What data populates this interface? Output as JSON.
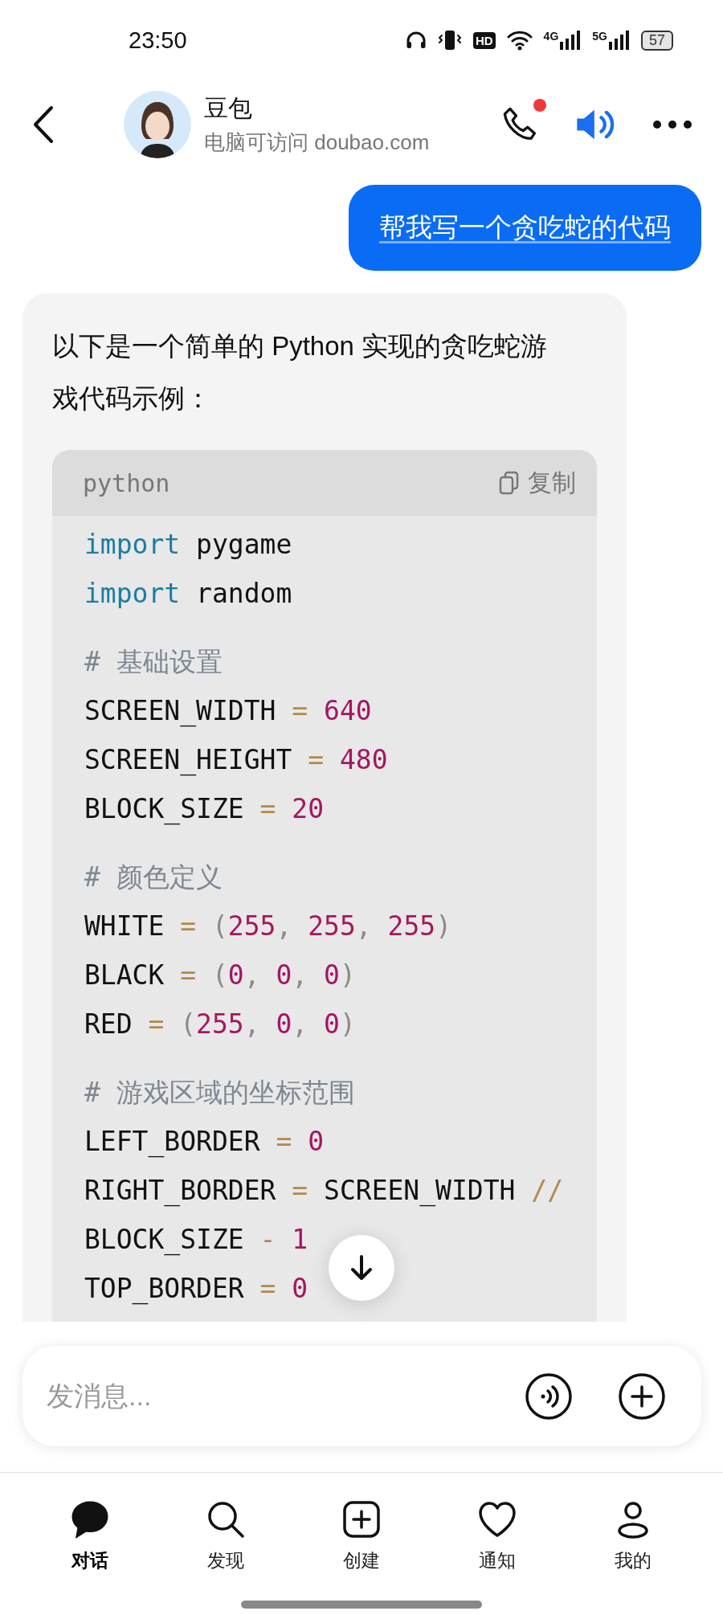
{
  "status_bar": {
    "time": "23:50",
    "hd": "HD",
    "net_4g": "4G",
    "net_5g": "5G",
    "battery": "57"
  },
  "header": {
    "name": "豆包",
    "subtitle": "电脑可访问 doubao.com",
    "call_badge": true
  },
  "messages": [
    {
      "kind": "user",
      "text": "帮我写一个贪吃蛇的代码"
    },
    {
      "kind": "assistant",
      "text": "以下是一个简单的 Python 实现的贪吃蛇游戏代码示例：",
      "code": {
        "language": "python",
        "copy_label": "复制",
        "groups": [
          [
            [
              {
                "kind": "kw",
                "text": "import"
              },
              {
                "kind": "plain",
                "text": " pygame"
              }
            ],
            [
              {
                "kind": "kw",
                "text": "import"
              },
              {
                "kind": "plain",
                "text": " random"
              }
            ]
          ],
          [
            [
              {
                "kind": "comment",
                "text": "# 基础设置"
              }
            ],
            [
              {
                "kind": "plain",
                "text": "SCREEN_WIDTH "
              },
              {
                "kind": "op",
                "text": "= "
              },
              {
                "kind": "num",
                "text": "640"
              }
            ],
            [
              {
                "kind": "plain",
                "text": "SCREEN_HEIGHT "
              },
              {
                "kind": "op",
                "text": "= "
              },
              {
                "kind": "num",
                "text": "480"
              }
            ],
            [
              {
                "kind": "plain",
                "text": "BLOCK_SIZE "
              },
              {
                "kind": "op",
                "text": "= "
              },
              {
                "kind": "num",
                "text": "20"
              }
            ]
          ],
          [
            [
              {
                "kind": "comment",
                "text": "# 颜色定义"
              }
            ],
            [
              {
                "kind": "plain",
                "text": "WHITE "
              },
              {
                "kind": "op",
                "text": "= "
              },
              {
                "kind": "punct",
                "text": "("
              },
              {
                "kind": "num",
                "text": "255"
              },
              {
                "kind": "punct",
                "text": ", "
              },
              {
                "kind": "num",
                "text": "255"
              },
              {
                "kind": "punct",
                "text": ", "
              },
              {
                "kind": "num",
                "text": "255"
              },
              {
                "kind": "punct",
                "text": ")"
              }
            ],
            [
              {
                "kind": "plain",
                "text": "BLACK "
              },
              {
                "kind": "op",
                "text": "= "
              },
              {
                "kind": "punct",
                "text": "("
              },
              {
                "kind": "num",
                "text": "0"
              },
              {
                "kind": "punct",
                "text": ", "
              },
              {
                "kind": "num",
                "text": "0"
              },
              {
                "kind": "punct",
                "text": ", "
              },
              {
                "kind": "num",
                "text": "0"
              },
              {
                "kind": "punct",
                "text": ")"
              }
            ],
            [
              {
                "kind": "plain",
                "text": "RED "
              },
              {
                "kind": "op",
                "text": "= "
              },
              {
                "kind": "punct",
                "text": "("
              },
              {
                "kind": "num",
                "text": "255"
              },
              {
                "kind": "punct",
                "text": ", "
              },
              {
                "kind": "num",
                "text": "0"
              },
              {
                "kind": "punct",
                "text": ", "
              },
              {
                "kind": "num",
                "text": "0"
              },
              {
                "kind": "punct",
                "text": ")"
              }
            ]
          ],
          [
            [
              {
                "kind": "comment",
                "text": "# 游戏区域的坐标范围"
              }
            ],
            [
              {
                "kind": "plain",
                "text": "LEFT_BORDER "
              },
              {
                "kind": "op",
                "text": "= "
              },
              {
                "kind": "num",
                "text": "0"
              }
            ],
            [
              {
                "kind": "plain",
                "text": "RIGHT_BORDER "
              },
              {
                "kind": "op",
                "text": "= "
              },
              {
                "kind": "plain",
                "text": "SCREEN_WIDTH "
              },
              {
                "kind": "op",
                "text": "//"
              }
            ],
            [
              {
                "kind": "plain",
                "text": "BLOCK_SIZE "
              },
              {
                "kind": "op",
                "text": "- "
              },
              {
                "kind": "num",
                "text": "1"
              }
            ],
            [
              {
                "kind": "plain",
                "text": "TOP_BORDER "
              },
              {
                "kind": "op",
                "text": "= "
              },
              {
                "kind": "num",
                "text": "0"
              }
            ]
          ]
        ]
      }
    }
  ],
  "input": {
    "placeholder": "发消息..."
  },
  "nav": [
    {
      "kind": "chat",
      "label": "对话",
      "selected": true
    },
    {
      "kind": "search",
      "label": "发现",
      "selected": false
    },
    {
      "kind": "create",
      "label": "创建",
      "selected": false
    },
    {
      "kind": "heart",
      "label": "通知",
      "selected": false
    },
    {
      "kind": "person",
      "label": "我的",
      "selected": false
    }
  ]
}
